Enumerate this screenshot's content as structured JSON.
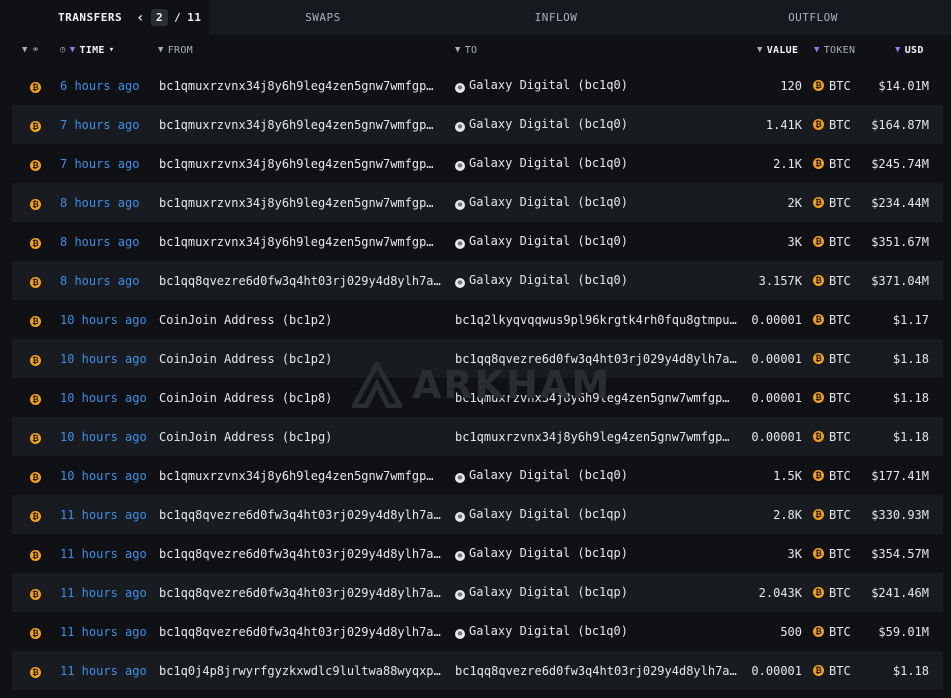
{
  "tabs": [
    {
      "label": "TRANSFERS",
      "active": true
    },
    {
      "label": "SWAPS"
    },
    {
      "label": "INFLOW"
    },
    {
      "label": "OUTFLOW"
    }
  ],
  "pager": {
    "current": "2",
    "separator": "/",
    "total": "11"
  },
  "columns": {
    "time": "TIME",
    "from": "FROM",
    "to": "TO",
    "value": "VALUE",
    "token": "TOKEN",
    "usd": "USD"
  },
  "watermark": "ARKHAM",
  "rows": [
    {
      "time": "6 hours ago",
      "from": "bc1qmuxrzvnx34j8y6h9leg4zen5gnw7wmfgp…",
      "from_entity": false,
      "to": "Galaxy Digital (bc1q0)",
      "to_entity": true,
      "value": "120",
      "token": "BTC",
      "usd": "$14.01M"
    },
    {
      "time": "7 hours ago",
      "from": "bc1qmuxrzvnx34j8y6h9leg4zen5gnw7wmfgp…",
      "from_entity": false,
      "to": "Galaxy Digital (bc1q0)",
      "to_entity": true,
      "value": "1.41K",
      "token": "BTC",
      "usd": "$164.87M"
    },
    {
      "time": "7 hours ago",
      "from": "bc1qmuxrzvnx34j8y6h9leg4zen5gnw7wmfgp…",
      "from_entity": false,
      "to": "Galaxy Digital (bc1q0)",
      "to_entity": true,
      "value": "2.1K",
      "token": "BTC",
      "usd": "$245.74M"
    },
    {
      "time": "8 hours ago",
      "from": "bc1qmuxrzvnx34j8y6h9leg4zen5gnw7wmfgp…",
      "from_entity": false,
      "to": "Galaxy Digital (bc1q0)",
      "to_entity": true,
      "value": "2K",
      "token": "BTC",
      "usd": "$234.44M"
    },
    {
      "time": "8 hours ago",
      "from": "bc1qmuxrzvnx34j8y6h9leg4zen5gnw7wmfgp…",
      "from_entity": false,
      "to": "Galaxy Digital (bc1q0)",
      "to_entity": true,
      "value": "3K",
      "token": "BTC",
      "usd": "$351.67M"
    },
    {
      "time": "8 hours ago",
      "from": "bc1qq8qvezre6d0fw3q4ht03rj029y4d8ylh7a…",
      "from_entity": false,
      "to": "Galaxy Digital (bc1q0)",
      "to_entity": true,
      "value": "3.157K",
      "token": "BTC",
      "usd": "$371.04M"
    },
    {
      "time": "10 hours ago",
      "from": "CoinJoin Address (bc1p2)",
      "from_entity": false,
      "to": "bc1q2lkyqvqqwus9pl96krgtk4rh0fqu8gtmpu…",
      "to_entity": false,
      "value": "0.00001",
      "token": "BTC",
      "usd": "$1.17"
    },
    {
      "time": "10 hours ago",
      "from": "CoinJoin Address (bc1p2)",
      "from_entity": false,
      "to": "bc1qq8qvezre6d0fw3q4ht03rj029y4d8ylh7a…",
      "to_entity": false,
      "value": "0.00001",
      "token": "BTC",
      "usd": "$1.18"
    },
    {
      "time": "10 hours ago",
      "from": "CoinJoin Address (bc1p8)",
      "from_entity": false,
      "to": "bc1qmuxrzvnx34j8y6h9leg4zen5gnw7wmfgp…",
      "to_entity": false,
      "value": "0.00001",
      "token": "BTC",
      "usd": "$1.18"
    },
    {
      "time": "10 hours ago",
      "from": "CoinJoin Address (bc1pg)",
      "from_entity": false,
      "to": "bc1qmuxrzvnx34j8y6h9leg4zen5gnw7wmfgp…",
      "to_entity": false,
      "value": "0.00001",
      "token": "BTC",
      "usd": "$1.18"
    },
    {
      "time": "10 hours ago",
      "from": "bc1qmuxrzvnx34j8y6h9leg4zen5gnw7wmfgp…",
      "from_entity": false,
      "to": "Galaxy Digital (bc1q0)",
      "to_entity": true,
      "value": "1.5K",
      "token": "BTC",
      "usd": "$177.41M"
    },
    {
      "time": "11 hours ago",
      "from": "bc1qq8qvezre6d0fw3q4ht03rj029y4d8ylh7a…",
      "from_entity": false,
      "to": "Galaxy Digital (bc1qp)",
      "to_entity": true,
      "value": "2.8K",
      "token": "BTC",
      "usd": "$330.93M"
    },
    {
      "time": "11 hours ago",
      "from": "bc1qq8qvezre6d0fw3q4ht03rj029y4d8ylh7a…",
      "from_entity": false,
      "to": "Galaxy Digital (bc1qp)",
      "to_entity": true,
      "value": "3K",
      "token": "BTC",
      "usd": "$354.57M"
    },
    {
      "time": "11 hours ago",
      "from": "bc1qq8qvezre6d0fw3q4ht03rj029y4d8ylh7a…",
      "from_entity": false,
      "to": "Galaxy Digital (bc1qp)",
      "to_entity": true,
      "value": "2.043K",
      "token": "BTC",
      "usd": "$241.46M"
    },
    {
      "time": "11 hours ago",
      "from": "bc1qq8qvezre6d0fw3q4ht03rj029y4d8ylh7a…",
      "from_entity": false,
      "to": "Galaxy Digital (bc1q0)",
      "to_entity": true,
      "value": "500",
      "token": "BTC",
      "usd": "$59.01M"
    },
    {
      "time": "11 hours ago",
      "from": "bc1q0j4p8jrwyrfgyzkxwdlc9lultwa88wyqxp…",
      "from_entity": false,
      "to": "bc1qq8qvezre6d0fw3q4ht03rj029y4d8ylh7a…",
      "to_entity": false,
      "value": "0.00001",
      "token": "BTC",
      "usd": "$1.18"
    }
  ],
  "colors": {
    "background": "#0f1114",
    "row_alt": "#181b1f",
    "time_link": "#3d8fe8",
    "btc": "#f2a11f",
    "filter_accent": "#8f7cf0"
  },
  "icons": {
    "chain": "bitcoin-icon",
    "filter": "filter-icon",
    "link": "link-icon",
    "clock": "clock-icon",
    "entity": "galaxy-digital-icon"
  }
}
